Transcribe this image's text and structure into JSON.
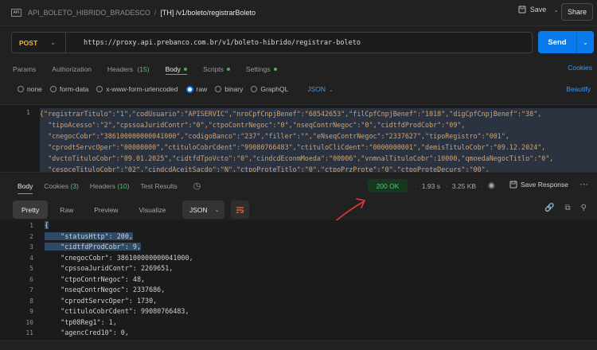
{
  "titlebar": {
    "collection": "API_BOLETO_HIBRIDO_BRADESCO",
    "separator": "/",
    "request_name": "[TH] /v1/boleto/registrarBoleto",
    "save_label": "Save",
    "share_label": "Share"
  },
  "request": {
    "method": "POST",
    "url": "https://proxy.api.prebanco.com.br/v1/boleto-hibrido/registrar-boleto",
    "send_label": "Send"
  },
  "request_tabs": [
    {
      "label": "Params",
      "count": ""
    },
    {
      "label": "Authorization",
      "count": ""
    },
    {
      "label": "Headers",
      "count": "(15)"
    },
    {
      "label": "Body",
      "count": ""
    },
    {
      "label": "Scripts",
      "count": ""
    },
    {
      "label": "Settings",
      "count": ""
    }
  ],
  "cookies_label": "Cookies",
  "body_types": [
    "none",
    "form-data",
    "x-www-form-urlencoded",
    "raw",
    "binary",
    "GraphQL"
  ],
  "body_format": "JSON",
  "beautify_label": "Beautify",
  "request_body": {
    "line_number": "1",
    "lines": [
      "{\"registrarTitulo\":\"1\",\"codUsuario\":\"APISERVIC\",\"nroCpfCnpjBenef\":\"68542653\",\"filCpfCnpjBenef\":\"1018\",\"digCpfCnpjBenef\":\"38\",",
      "  \"tipoAcesso\":\"2\",\"cpssoaJuridContr\":\"0\",\"ctpoContrNegoc\":\"0\",\"nseqContrNegoc\":\"0\",\"cidtfdProdCobr\":\"09\",",
      "  \"cnegocCobr\":\"386100000000041000\",\"codigoBanco\":\"237\",\"filler\":\"\",\"eNseqContrNegoc\":\"2337627\",\"tipoRegistro\":\"001\",",
      "  \"cprodtServcOper\":\"00000000\",\"ctituloCobrCdent\":\"99080766483\",\"ctituloCliCdent\":\"0000000001\",\"demisTituloCobr\":\"09.12.2024\",",
      "  \"dvctoTituloCobr\":\"09.01.2025\",\"cidtfdTpoVcto\":\"0\",\"cindcdEconmMoeda\":\"00006\",\"vnmnalTituloCobr\":10000,\"qmoedaNegocTitlo\":\"0\",",
      "  \"cespceTituloCobr\":\"02\",\"cindcdAceitSacdo\":\"N\",\"ctpoProteTitlo\":\"0\",\"ctpoPrzProte\":\"0\",\"ctpoProteDecurs\":\"00\","
    ]
  },
  "response_tabs": [
    {
      "label": "Body",
      "count": ""
    },
    {
      "label": "Cookies",
      "count": "(3)"
    },
    {
      "label": "Headers",
      "count": "(10)"
    },
    {
      "label": "Test Results",
      "count": ""
    }
  ],
  "response_meta": {
    "status": "200 OK",
    "time": "1.93 s",
    "size": "3.25 KB",
    "save_response_label": "Save Response"
  },
  "view_tabs": [
    "Pretty",
    "Raw",
    "Preview",
    "Visualize"
  ],
  "response_format": "JSON",
  "response_lines": [
    {
      "num": "1",
      "text": "{"
    },
    {
      "num": "2",
      "text": "    \"statusHttp\": 200,"
    },
    {
      "num": "3",
      "text": "    \"cidtfdProdCobr\": 9,"
    },
    {
      "num": "4",
      "text": "    \"cnegocCobr\": 386100000000041000,"
    },
    {
      "num": "5",
      "text": "    \"cpssoaJuridContr\": 2269651,"
    },
    {
      "num": "6",
      "text": "    \"ctpoContrNegoc\": 48,"
    },
    {
      "num": "7",
      "text": "    \"nseqContrNegoc\": 2337686,"
    },
    {
      "num": "8",
      "text": "    \"cprodtServcOper\": 1730,"
    },
    {
      "num": "9",
      "text": "    \"ctituloCobrCdent\": 99080766483,"
    },
    {
      "num": "10",
      "text": "    \"tp08Reg1\": 1,"
    },
    {
      "num": "11",
      "text": "    \"agencCred10\": 0,"
    }
  ],
  "colors": {
    "accent": "#ff6c37",
    "send": "#097bed",
    "status_ok": "#4ecb71",
    "annotation": "#e53935"
  }
}
